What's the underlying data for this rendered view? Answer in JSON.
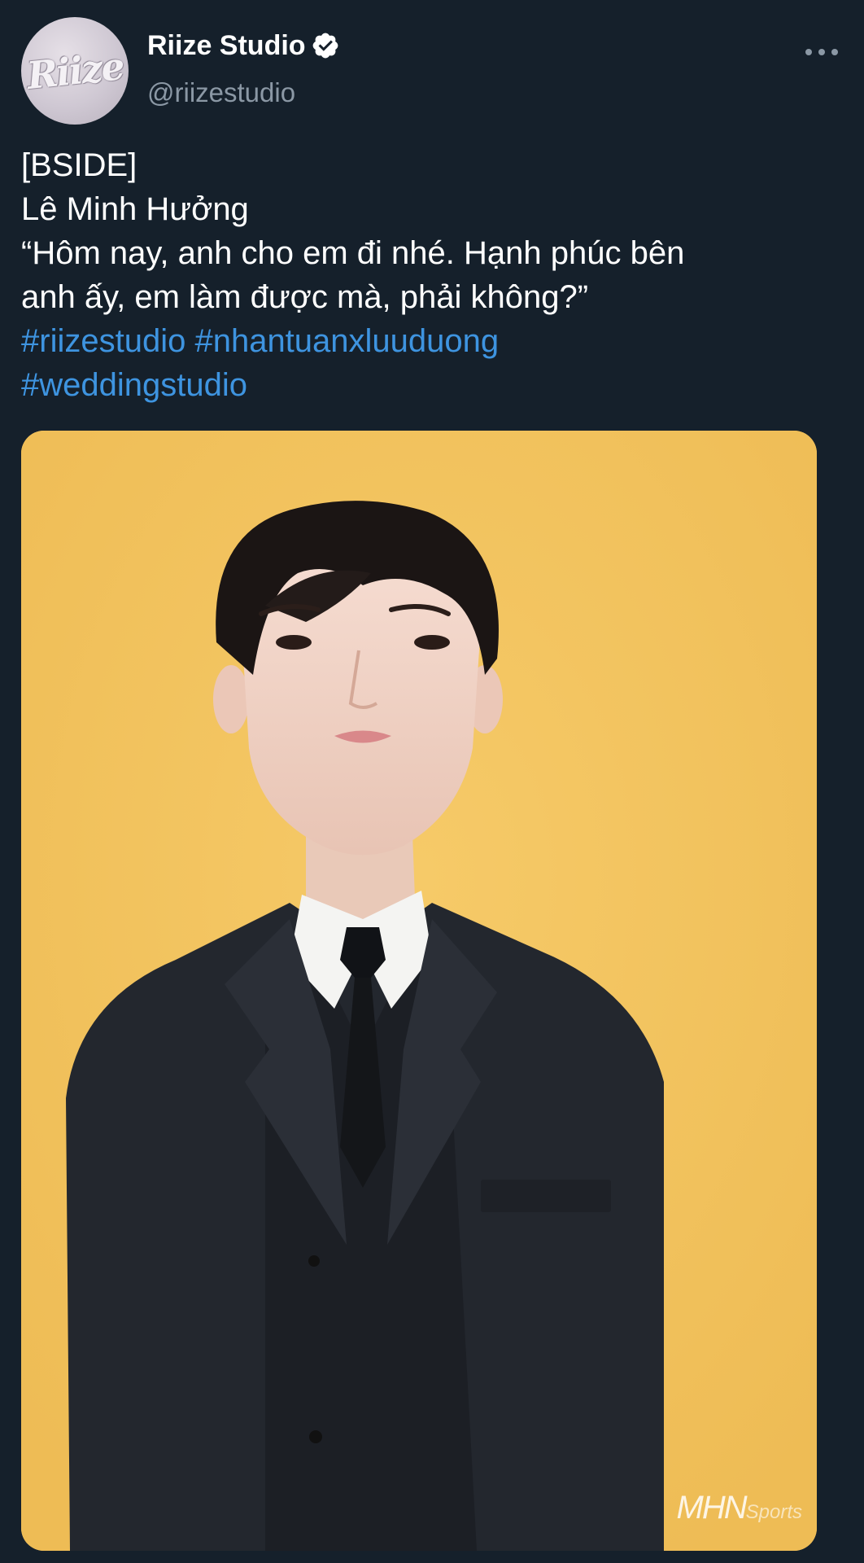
{
  "tweet": {
    "author": {
      "display_name": "Riize Studio",
      "handle": "@riizestudio",
      "verified": true,
      "avatar_logo_text": "Riize",
      "avatar_icon": "avatar-logo"
    },
    "more_icon": "more-horizontal-icon",
    "text_lines": [
      "[BSIDE]",
      "Lê Minh Hưởng",
      "“Hôm nay, anh cho em đi nhé. Hạnh phúc bên",
      "anh ấy, em làm được mà, phải không?”"
    ],
    "hashtags_line1": [
      "#riizestudio",
      "#nhantuanxluuduong"
    ],
    "hashtags_line2": [
      "#weddingstudio"
    ],
    "media": {
      "watermark_main": "MHN",
      "watermark_sub": "Sports",
      "background_color": "#f1c15e"
    }
  },
  "colors": {
    "background": "#15202b",
    "text": "#ffffff",
    "secondary": "#8b98a5",
    "link": "#3e94e0",
    "verified": "#ffffff"
  }
}
